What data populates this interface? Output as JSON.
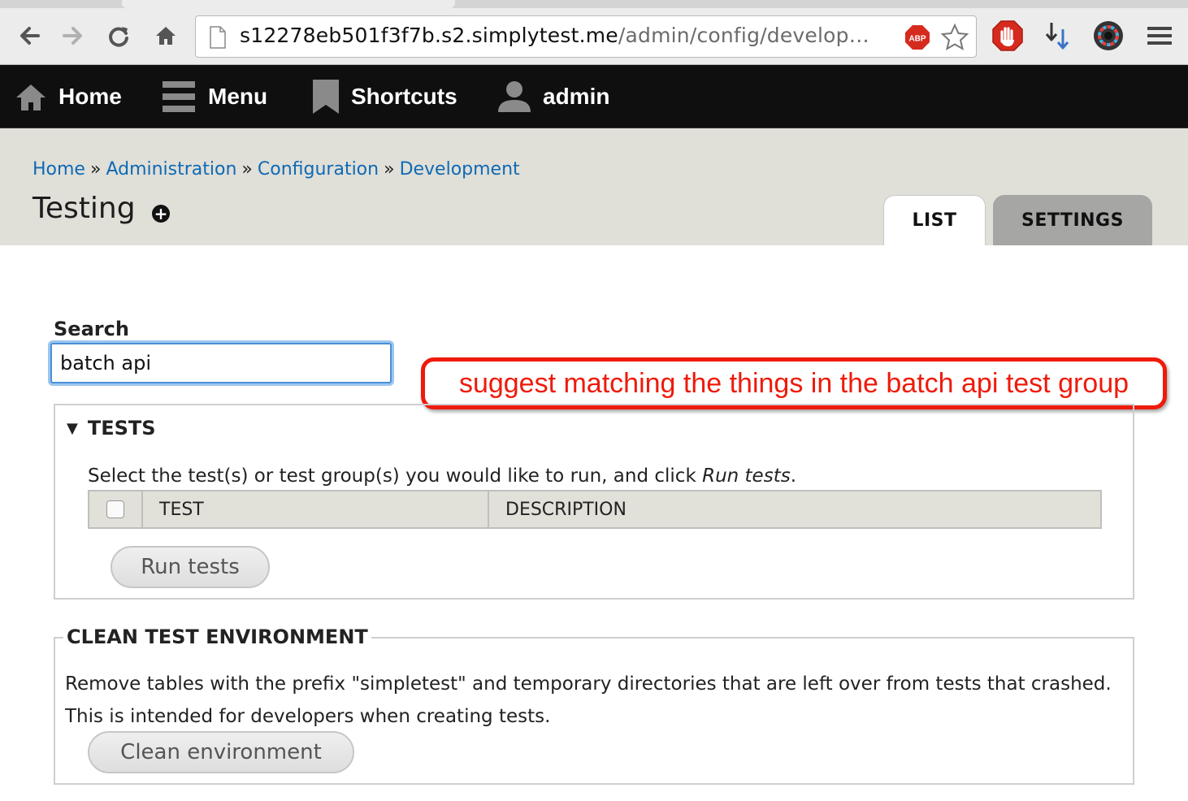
{
  "browser": {
    "url_host": "s12278eb501f3f7b.s2.simplytest.me",
    "url_path": "/admin/config/develop…",
    "abp_label": "ABP"
  },
  "toolbar": {
    "home": "Home",
    "menu": "Menu",
    "shortcuts": "Shortcuts",
    "user": "admin"
  },
  "breadcrumb": {
    "items": [
      "Home",
      "Administration",
      "Configuration",
      "Development"
    ],
    "separator": "»"
  },
  "page": {
    "title": "Testing",
    "tabs": [
      "LIST",
      "SETTINGS"
    ],
    "active_tab": "LIST"
  },
  "search": {
    "label": "Search",
    "value": "batch api"
  },
  "annotation": {
    "text": "suggest matching the things in the batch api test group",
    "color": "#ef1a0a"
  },
  "tests": {
    "legend": "TESTS",
    "description_before": "Select the test(s) or test group(s) you would like to run, and click ",
    "description_em": "Run tests",
    "description_after": ".",
    "columns": [
      "TEST",
      "DESCRIPTION"
    ],
    "run_button": "Run tests"
  },
  "clean": {
    "legend": "CLEAN TEST ENVIRONMENT",
    "description": "Remove tables with the prefix \"simpletest\" and temporary directories that are left over from tests that crashed. This is intended for developers when creating tests.",
    "button": "Clean environment"
  },
  "colors": {
    "link": "#0f6ab4",
    "toolbar_bg": "#0f0f0f",
    "header_bg": "#e0dfd8"
  }
}
